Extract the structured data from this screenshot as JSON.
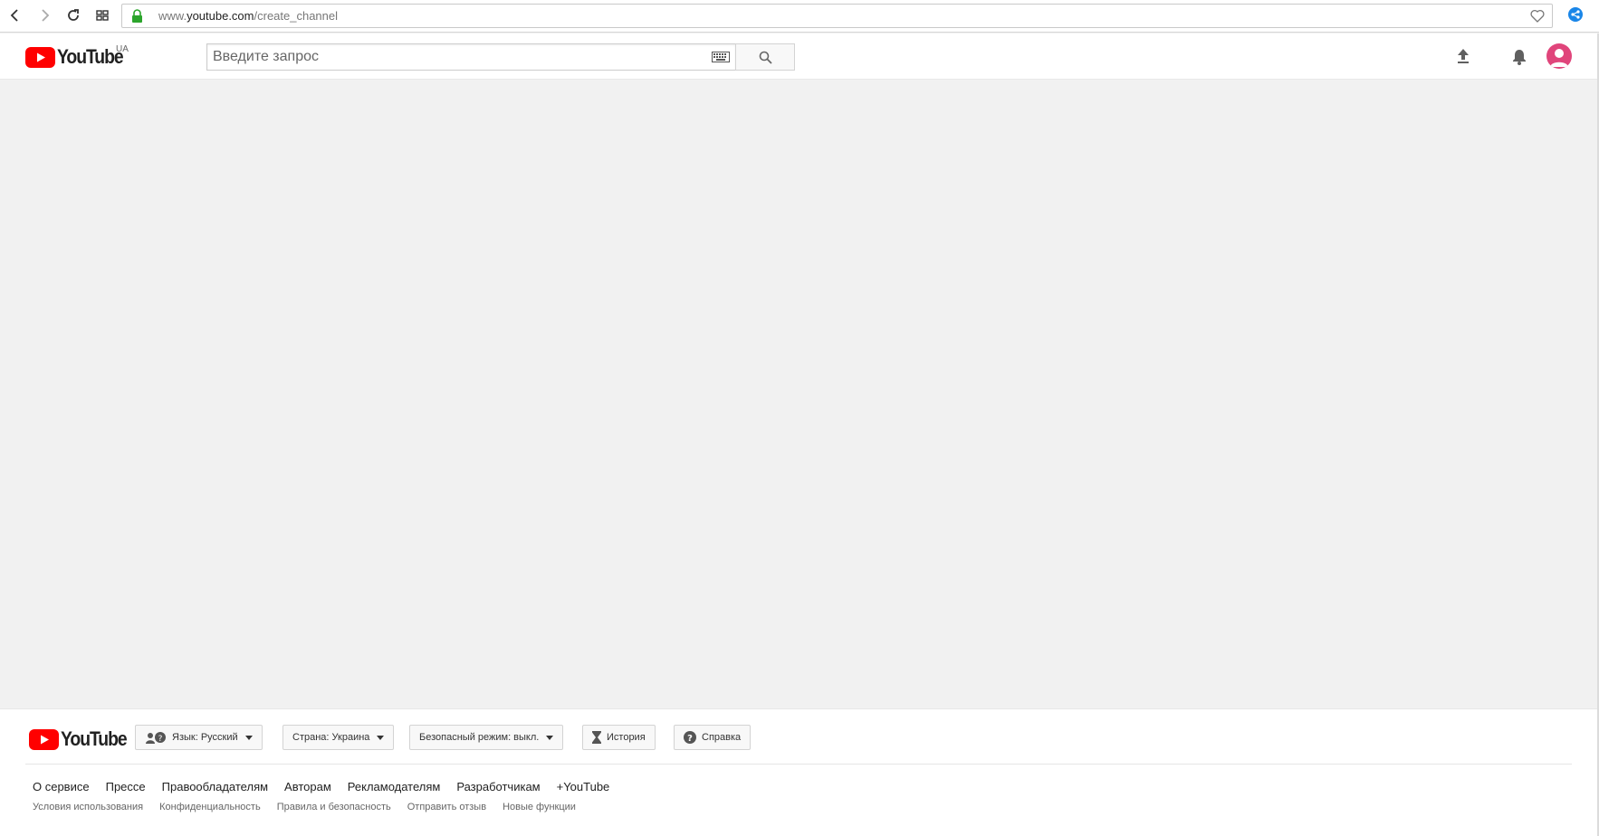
{
  "browser": {
    "url_prefix": "www.",
    "url_host": "youtube.com",
    "url_path": "/create_channel",
    "icons": [
      "back-icon",
      "forward-icon",
      "reload-icon",
      "grid-icon",
      "lock-icon",
      "heart-icon",
      "share-icon"
    ]
  },
  "header": {
    "logo_text": "YouTube",
    "country_code": "UA",
    "search_placeholder": "Введите запрос",
    "brand_color": "#ff0000",
    "avatar_color": "#e0457b"
  },
  "footer": {
    "logo_text": "YouTube",
    "language_picker": "Язык: Русский",
    "country_picker": "Страна: Украина",
    "safety_picker": "Безопасный режим: выкл.",
    "history_button": "История",
    "help_button": "Справка",
    "primary_links": [
      "О сервисе",
      "Прессе",
      "Правообладателям",
      "Авторам",
      "Рекламодателям",
      "Разработчикам",
      "+YouTube"
    ],
    "secondary_links": [
      "Условия использования",
      "Конфиденциальность",
      "Правила и безопасность",
      "Отправить отзыв",
      "Новые функции"
    ]
  }
}
